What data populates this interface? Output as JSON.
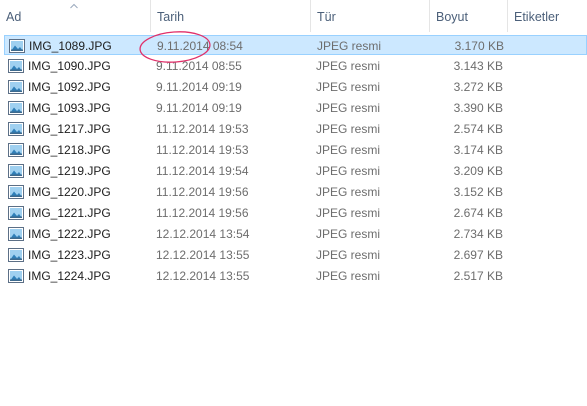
{
  "columns": {
    "name": "Ad",
    "date": "Tarih",
    "type": "Tür",
    "size": "Boyut",
    "tags": "Etiketler"
  },
  "files": [
    {
      "name": "IMG_1089.JPG",
      "date": "9.11.2014 08:54",
      "type": "JPEG resmi",
      "size": "3.170 KB",
      "selected": true
    },
    {
      "name": "IMG_1090.JPG",
      "date": "9.11.2014 08:55",
      "type": "JPEG resmi",
      "size": "3.143 KB"
    },
    {
      "name": "IMG_1092.JPG",
      "date": "9.11.2014 09:19",
      "type": "JPEG resmi",
      "size": "3.272 KB"
    },
    {
      "name": "IMG_1093.JPG",
      "date": "9.11.2014 09:19",
      "type": "JPEG resmi",
      "size": "3.390 KB"
    },
    {
      "name": "IMG_1217.JPG",
      "date": "11.12.2014 19:53",
      "type": "JPEG resmi",
      "size": "2.574 KB"
    },
    {
      "name": "IMG_1218.JPG",
      "date": "11.12.2014 19:53",
      "type": "JPEG resmi",
      "size": "3.174 KB"
    },
    {
      "name": "IMG_1219.JPG",
      "date": "11.12.2014 19:54",
      "type": "JPEG resmi",
      "size": "3.209 KB"
    },
    {
      "name": "IMG_1220.JPG",
      "date": "11.12.2014 19:56",
      "type": "JPEG resmi",
      "size": "3.152 KB"
    },
    {
      "name": "IMG_1221.JPG",
      "date": "11.12.2014 19:56",
      "type": "JPEG resmi",
      "size": "2.674 KB"
    },
    {
      "name": "IMG_1222.JPG",
      "date": "12.12.2014 13:54",
      "type": "JPEG resmi",
      "size": "2.734 KB"
    },
    {
      "name": "IMG_1223.JPG",
      "date": "12.12.2014 13:55",
      "type": "JPEG resmi",
      "size": "2.697 KB"
    },
    {
      "name": "IMG_1224.JPG",
      "date": "12.12.2014 13:55",
      "type": "JPEG resmi",
      "size": "2.517 KB"
    }
  ],
  "colors": {
    "selection_bg": "#cce8ff",
    "selection_border": "#99d1ff",
    "header_text": "#4c607a",
    "annotation": "#e0306a"
  }
}
